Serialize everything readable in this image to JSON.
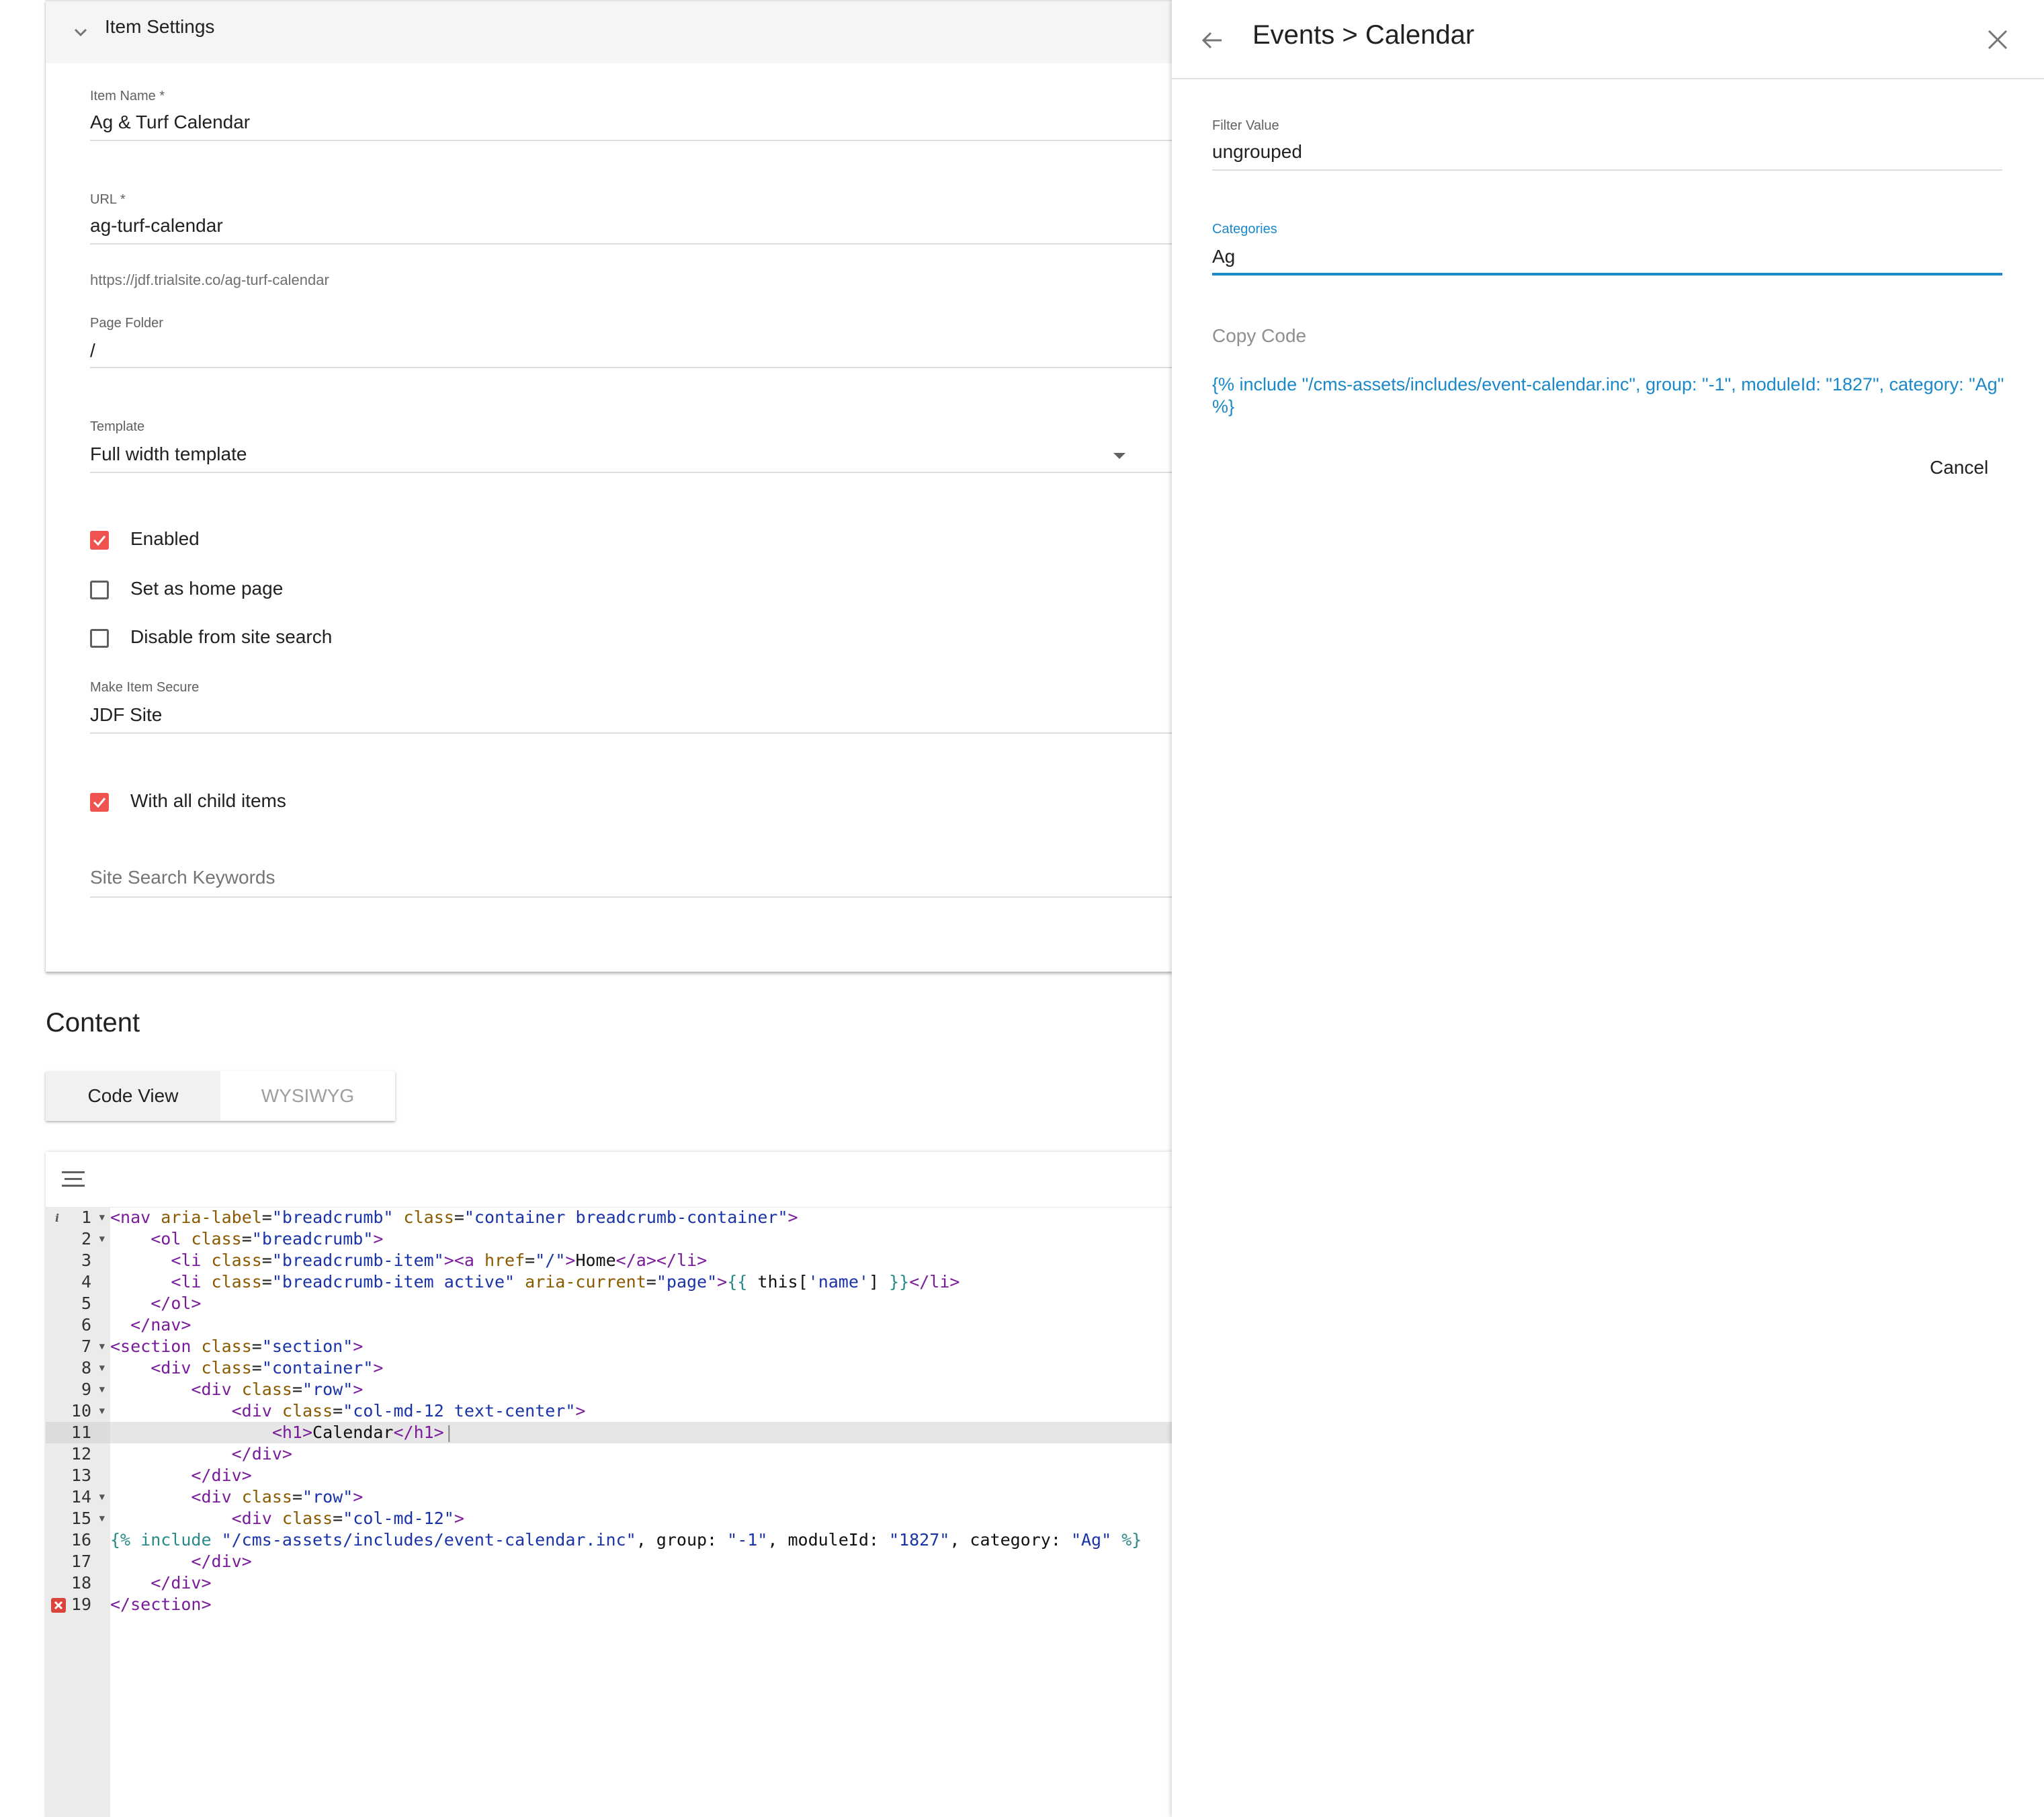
{
  "item_settings": {
    "title": "Item Settings",
    "item_name": {
      "label": "Item Name *",
      "value": "Ag & Turf Calendar"
    },
    "url": {
      "label": "URL *",
      "value": "ag-turf-calendar",
      "helper": "https://jdf.trialsite.co/ag-turf-calendar"
    },
    "page_folder": {
      "label": "Page Folder",
      "value": "/"
    },
    "template": {
      "label": "Template",
      "value": "Full width template"
    },
    "checkboxes": [
      {
        "label": "Enabled",
        "checked": true
      },
      {
        "label": "Set as home page",
        "checked": false
      },
      {
        "label": "Disable from site search",
        "checked": false
      }
    ],
    "make_item_secure": {
      "label": "Make Item Secure",
      "value": "JDF Site"
    },
    "child_items": {
      "label": "With all child items",
      "checked": true
    },
    "site_search_keywords": {
      "placeholder": "Site Search Keywords"
    }
  },
  "content": {
    "title": "Content",
    "tabs": [
      {
        "label": "Code View",
        "active": true
      },
      {
        "label": "WYSIWYG",
        "active": false
      }
    ],
    "active_line": 11,
    "error_line": 19
  },
  "panel": {
    "title": "Events > Calendar",
    "filter_value": {
      "label": "Filter Value",
      "value": "ungrouped"
    },
    "categories": {
      "label": "Categories",
      "value": "Ag"
    },
    "copy_code_label": "Copy Code",
    "include_code": "{% include \"/cms-assets/includes/event-calendar.inc\", group: \"-1\", moduleId: \"1827\", category: \"Ag\" %}",
    "cancel_label": "Cancel"
  },
  "colors": {
    "accent": "#1a88c9",
    "checkbox_checked": "#ef5350",
    "error_marker": "#d9443b"
  },
  "icons": [
    "chevron-down-icon",
    "menu-icon",
    "info-icon",
    "error-icon",
    "back-arrow-icon",
    "close-icon",
    "dropdown-arrow-icon"
  ]
}
